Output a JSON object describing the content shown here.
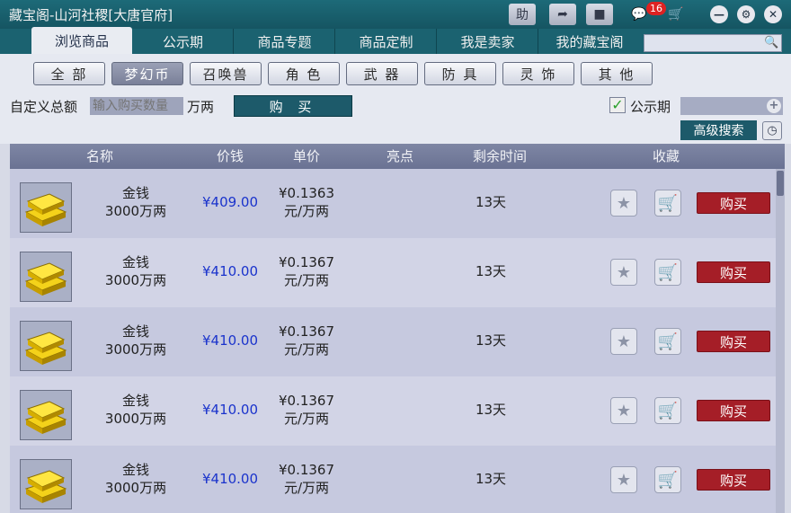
{
  "window": {
    "title": "藏宝阁-山河社稷[大唐官府]",
    "help_label": "助",
    "message_count": "16"
  },
  "tabs": [
    {
      "label": "浏览商品",
      "active": true
    },
    {
      "label": "公示期",
      "active": false
    },
    {
      "label": "商品专题",
      "active": false
    },
    {
      "label": "商品定制",
      "active": false
    },
    {
      "label": "我是卖家",
      "active": false
    },
    {
      "label": "我的藏宝阁",
      "active": false
    }
  ],
  "search": {
    "placeholder": ""
  },
  "categories": [
    {
      "label": "全 部",
      "active": false
    },
    {
      "label": "梦幻币",
      "active": true
    },
    {
      "label": "召唤兽",
      "active": false
    },
    {
      "label": "角 色",
      "active": false
    },
    {
      "label": "武 器",
      "active": false
    },
    {
      "label": "防 具",
      "active": false
    },
    {
      "label": "灵 饰",
      "active": false
    },
    {
      "label": "其 他",
      "active": false
    }
  ],
  "custom": {
    "label": "自定义总额",
    "placeholder": "输入购买数量",
    "unit": "万两",
    "buy_label": "购 买",
    "public_label": "公示期",
    "public_checked": true,
    "advanced_search": "高级搜索"
  },
  "table": {
    "headers": [
      "名称",
      "价钱",
      "单价",
      "亮点",
      "剩余时间",
      "收藏"
    ],
    "rows": [
      {
        "name": "金钱",
        "amount": "3000万两",
        "price": "¥409.00",
        "unit_price": "¥0.1363",
        "unit": "元/万两",
        "highlight": "",
        "time": "13天",
        "buy": "购买"
      },
      {
        "name": "金钱",
        "amount": "3000万两",
        "price": "¥410.00",
        "unit_price": "¥0.1367",
        "unit": "元/万两",
        "highlight": "",
        "time": "13天",
        "buy": "购买"
      },
      {
        "name": "金钱",
        "amount": "3000万两",
        "price": "¥410.00",
        "unit_price": "¥0.1367",
        "unit": "元/万两",
        "highlight": "",
        "time": "13天",
        "buy": "购买"
      },
      {
        "name": "金钱",
        "amount": "3000万两",
        "price": "¥410.00",
        "unit_price": "¥0.1367",
        "unit": "元/万两",
        "highlight": "",
        "time": "13天",
        "buy": "购买"
      },
      {
        "name": "金钱",
        "amount": "3000万两",
        "price": "¥410.00",
        "unit_price": "¥0.1367",
        "unit": "元/万两",
        "highlight": "",
        "time": "13天",
        "buy": "购买"
      }
    ]
  },
  "colors": {
    "titlebar": "#1d6a78",
    "buy_button": "#a51e27",
    "price_text": "#1a33cc"
  }
}
